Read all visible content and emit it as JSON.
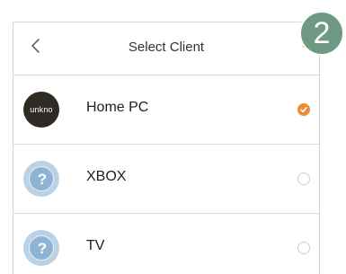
{
  "header": {
    "title": "Select Client",
    "back_icon": "chevron-left-icon"
  },
  "clients": [
    {
      "name": "Home PC",
      "avatar_text": "unkno",
      "avatar_type": "unknown-avatar",
      "selected": true
    },
    {
      "name": "XBOX",
      "avatar_type": "help-icon",
      "selected": false
    },
    {
      "name": "TV",
      "avatar_type": "help-icon",
      "selected": false
    }
  ],
  "step_badge": {
    "number": "2"
  },
  "colors": {
    "accent": "#f08b35",
    "badge": "#6e9a84",
    "help_icon": "#8fb4d3",
    "avatar_dark": "#2f2a23"
  }
}
